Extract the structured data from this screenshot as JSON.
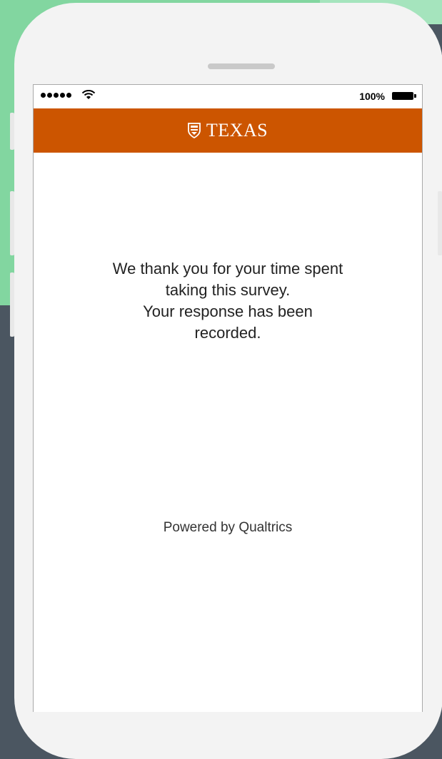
{
  "status_bar": {
    "battery_percent": "100%"
  },
  "header": {
    "logo_text": "TEXAS",
    "background_color": "#cc5500"
  },
  "message": {
    "line1": "We thank you for your time spent",
    "line2": "taking this survey.",
    "line3": "Your response has been",
    "line4": "recorded."
  },
  "footer": {
    "powered_by": "Powered by Qualtrics"
  }
}
